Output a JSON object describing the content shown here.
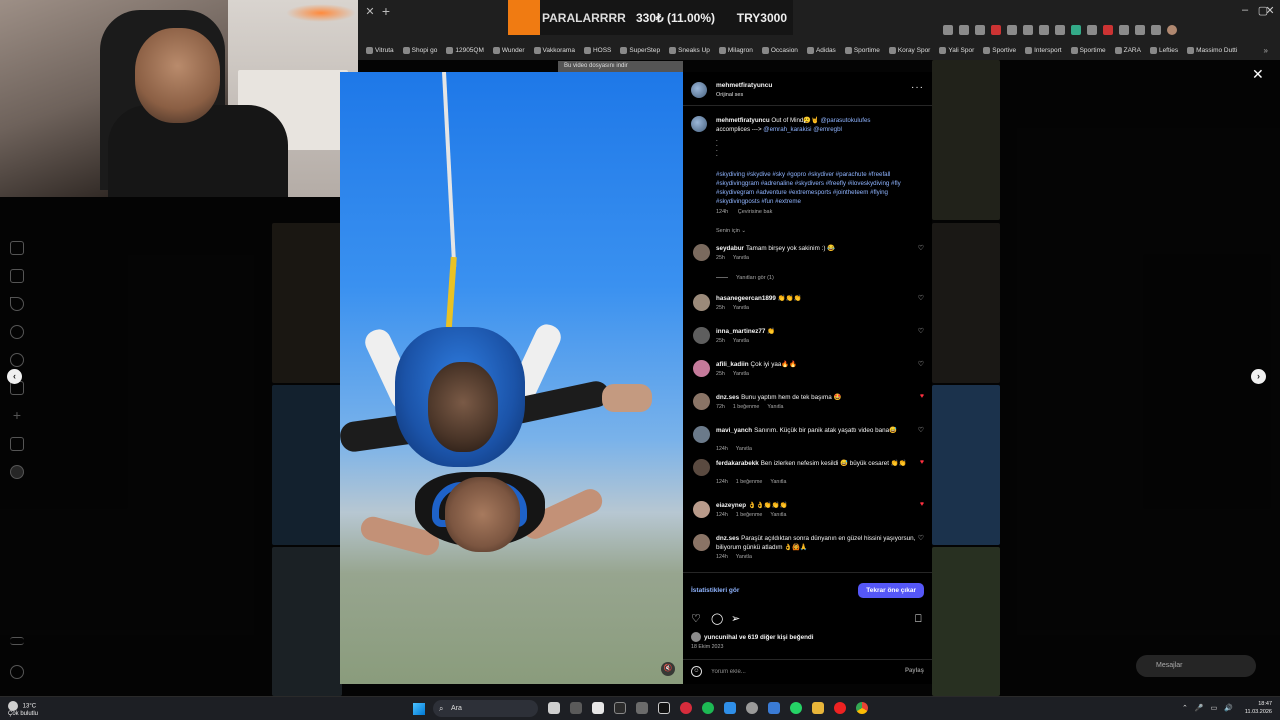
{
  "browser": {
    "ticker": {
      "name": "PARALARRRR",
      "change": "330₺ (11.00%)",
      "value": "TRY3000"
    },
    "bookmarks": [
      "Vitruta",
      "Shopi go",
      "12905QM",
      "Wunder",
      "Vakkorama",
      "HOSS",
      "SuperStep",
      "Sneaks Up",
      "Milagron",
      "Occasion",
      "Adidas",
      "Sportime",
      "Koray Spor",
      "Yali Spor",
      "Sportive",
      "Intersport",
      "Sportime",
      "ZARA",
      "Lefties",
      "Massimo Dutti"
    ],
    "video_banner": "Bu video dosyasını indir"
  },
  "post": {
    "username": "mehmetfiratyuncu",
    "audio": "Orijinal ses",
    "caption": {
      "user": "mehmetfiratyuncu",
      "text": "Out of Mind😮‍💨🤘",
      "mention1": "@parasutokulufes",
      "line2": "accomplices --->",
      "mention2": "@emrah_karakisi",
      "mention3": "@emregbl",
      "dots": ".\n.\n.\n.",
      "hashtags": "#skydiving #skydive #sky #gopro #skydiver #parachute #freefall #skydivinggram #adrenaline #skydivers #freefly #iloveskydiving #fly #skydivegram #adventure #extremesports #jointheteem #flying #skydivingposts #fun #extreme",
      "age": "124h",
      "translate": "Çevirisine bak"
    },
    "for_you": "Senin için ⌄",
    "comments": [
      {
        "user": "seydabur",
        "text": "Tamam birşey yok sakinim :) 😂",
        "age": "25h",
        "likes": "",
        "reply": "Yanıtla",
        "liked": false
      },
      {
        "user": "hasanegeercan1899",
        "text": "👏👏👏",
        "age": "25h",
        "likes": "",
        "reply": "Yanıtla",
        "liked": false
      },
      {
        "user": "inna_martinez77",
        "text": "👏",
        "age": "25h",
        "likes": "",
        "reply": "Yanıtla",
        "liked": false
      },
      {
        "user": "afili_kadiin",
        "text": "Çok iyi yaa🔥🔥",
        "age": "25h",
        "likes": "",
        "reply": "Yanıtla",
        "liked": false
      },
      {
        "user": "dnz.ses",
        "text": "Bunu yaptım hem de tek başıma 🤩",
        "age": "72h",
        "likes": "1 beğenme",
        "reply": "Yanıtla",
        "liked": true
      },
      {
        "user": "mavi_yanch",
        "text": "Sanırım. Küçük bir panik atak yaşattı video bana😅",
        "age": "124h",
        "likes": "",
        "reply": "Yanıtla",
        "liked": false
      },
      {
        "user": "ferdakarabekk",
        "text": "Ben izlerken nefesim kesildi 😅 büyük cesaret 👏👏",
        "age": "124h",
        "likes": "1 beğenme",
        "reply": "Yanıtla",
        "liked": true
      },
      {
        "user": "eiazeynep",
        "text": "👌👌👏👏👏",
        "age": "124h",
        "likes": "1 beğenme",
        "reply": "Yanıtla",
        "liked": true
      },
      {
        "user": "dnz.ses",
        "text": "Paraşüt açıldıktan sonra dünyanın en güzel hissini yaşıyorsun, biliyorum günkü atladım 👌🙆🙏",
        "age": "124h",
        "likes": "",
        "reply": "Yanıtla",
        "liked": false
      }
    ],
    "view_replies": "Yanıtları gör (1)",
    "stats_link": "İstatistikleri gör",
    "boost_button": "Tekrar öne çıkar",
    "liked_by": "yuncunihal ve 619 diğer kişi beğendi",
    "date": "18 Ekim 2023",
    "comment_placeholder": "Yorum ekle...",
    "share": "Paylaş"
  },
  "messages": "Mesajlar",
  "taskbar": {
    "weather_temp": "13°C",
    "weather_desc": "Çok bulutlu",
    "search": "Ara",
    "time": "18:47",
    "date": "11.03.2026"
  },
  "colors": {
    "accent": "#5557f7",
    "link": "#8fb4ff",
    "liked_heart": "#ff3040"
  }
}
